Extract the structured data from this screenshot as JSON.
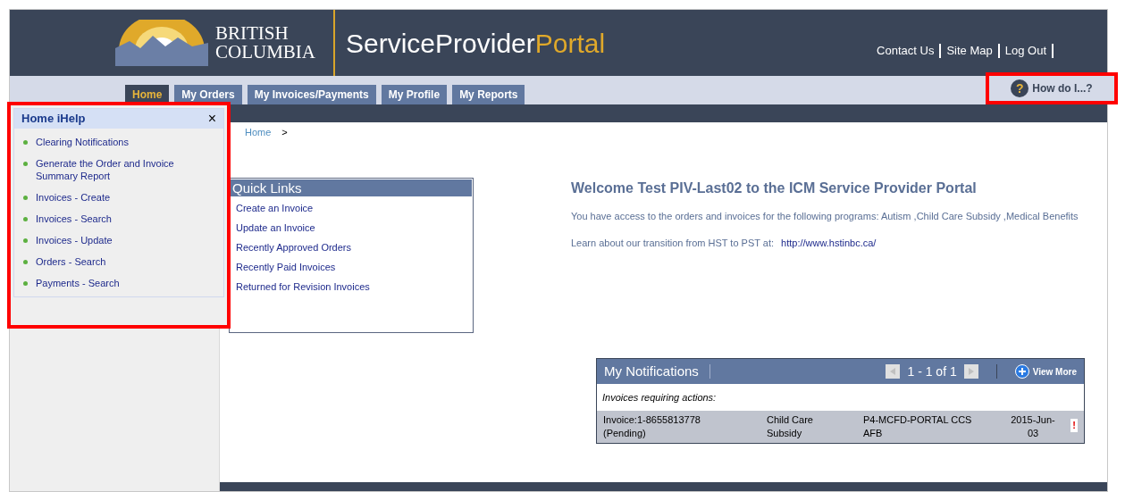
{
  "header": {
    "logo_line1": "BRITISH",
    "logo_line2": "COLUMBIA",
    "title_main": "ServiceProvider",
    "title_accent": "Portal",
    "links": [
      "Contact Us",
      "Site Map",
      "Log Out"
    ]
  },
  "tabs": [
    {
      "label": "Home",
      "selected": true
    },
    {
      "label": "My Orders",
      "selected": false
    },
    {
      "label": "My Invoices/Payments",
      "selected": false
    },
    {
      "label": "My Profile",
      "selected": false
    },
    {
      "label": "My Reports",
      "selected": false
    }
  ],
  "help_button": {
    "icon_char": "?",
    "label": "How do I...?",
    "highlighted": true
  },
  "ihelp": {
    "title": "Home iHelp",
    "close": "×",
    "highlighted": true,
    "items": [
      "Clearing Notifications",
      "Generate the Order and Invoice Summary Report",
      "Invoices - Create",
      "Invoices - Search",
      "Invoices - Update",
      "Orders - Search",
      "Payments - Search"
    ]
  },
  "breadcrumb": {
    "items": [
      "Home"
    ],
    "separator": ">"
  },
  "quick_links": {
    "title": "Quick Links",
    "items": [
      "Create an Invoice",
      "Update an Invoice",
      "Recently Approved Orders",
      "Recently Paid Invoices",
      "Returned for Revision Invoices"
    ]
  },
  "welcome": {
    "title": "Welcome Test PIV-Last02 to the ICM Service Provider Portal",
    "access_text": "You have access to the orders and invoices for the following programs: Autism ,Child Care Subsidy ,Medical Benefits",
    "transition_text": "Learn about our transition from HST to PST at:",
    "transition_link": "http://www.hstinbc.ca/"
  },
  "notifications": {
    "title": "My Notifications",
    "pager": "1 - 1 of 1",
    "view_more": "View More",
    "section": "Invoices requiring actions:",
    "rows": [
      {
        "invoice": "Invoice:1-8655813778 (Pending)",
        "program": "Child Care Subsidy",
        "provider": "P4-MCFD-PORTAL CCS AFB",
        "date": "2015-Jun-03",
        "flag": "!"
      }
    ]
  }
}
